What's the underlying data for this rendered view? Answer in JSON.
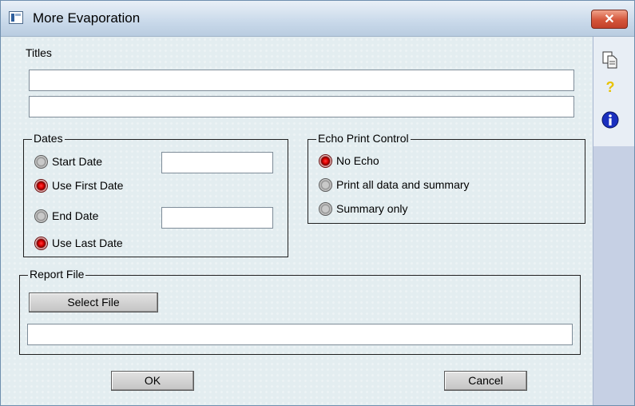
{
  "window": {
    "title": "More Evaporation",
    "close_glyph": "✕"
  },
  "titles": {
    "label": "Titles",
    "line1": "",
    "line2": ""
  },
  "dates": {
    "legend": "Dates",
    "start_date_label": "Start Date",
    "start_date_value": "",
    "use_first_date_label": "Use First Date",
    "end_date_label": "End Date",
    "end_date_value": "",
    "use_last_date_label": "Use Last Date",
    "selected": [
      "Use First Date",
      "Use Last Date"
    ]
  },
  "echo": {
    "legend": "Echo Print Control",
    "options": [
      "No Echo",
      "Print all data and summary",
      "Summary only"
    ],
    "selected": "No Echo"
  },
  "report": {
    "legend": "Report File",
    "select_button": "Select File",
    "path": ""
  },
  "footer": {
    "ok": "OK",
    "cancel": "Cancel"
  },
  "sidebar": {
    "icons": [
      "copy-icon",
      "help-icon",
      "info-icon"
    ]
  },
  "colors": {
    "selected_radio": "#e00000",
    "close_button": "#d4553a",
    "info_icon": "#1a2fbf",
    "help_icon": "#e8c200"
  }
}
